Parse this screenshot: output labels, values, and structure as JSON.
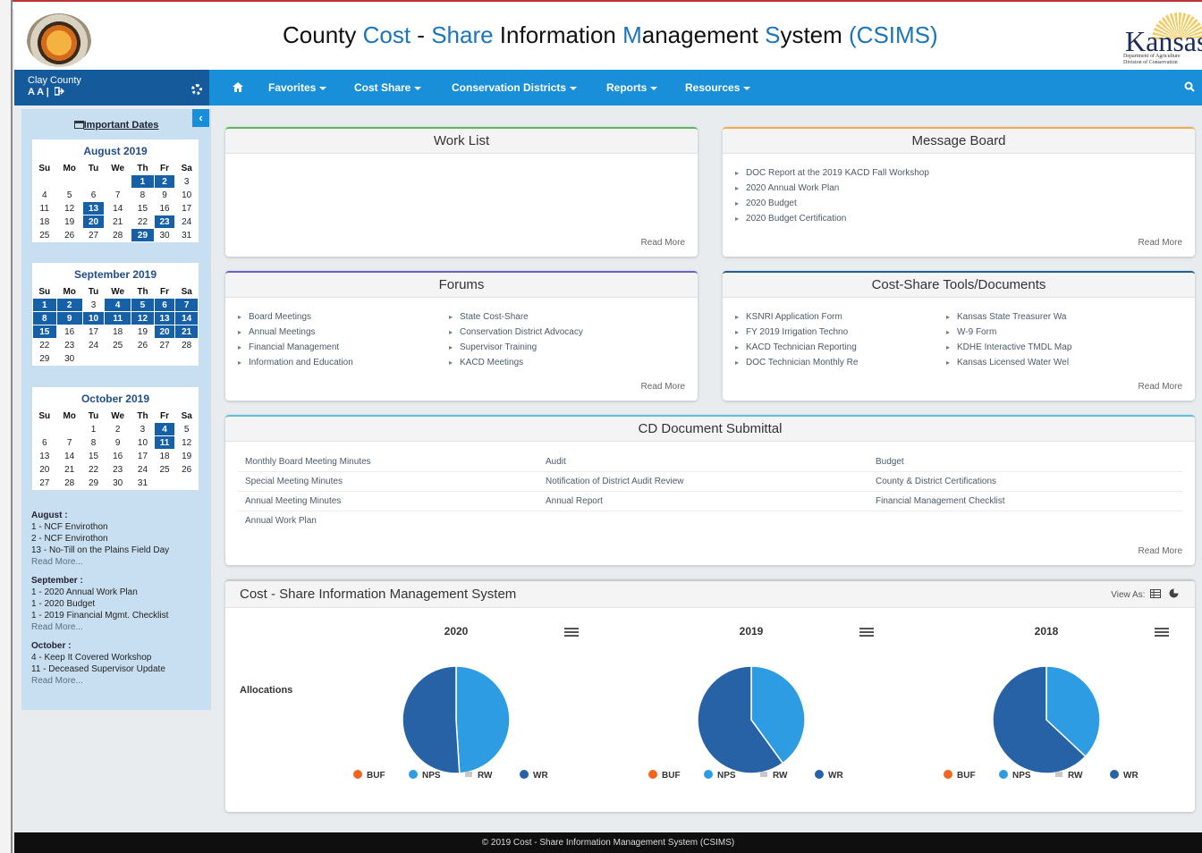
{
  "header": {
    "title_parts": [
      {
        "text": "County ",
        "hl": false
      },
      {
        "text": "Cost",
        "hl": true
      },
      {
        "text": " - ",
        "hl": false
      },
      {
        "text": "Share ",
        "hl": true
      },
      {
        "text": "Information ",
        "hl": false
      },
      {
        "text": "M",
        "hl": true
      },
      {
        "text": "anagement ",
        "hl": false
      },
      {
        "text": "S",
        "hl": true
      },
      {
        "text": "ystem ",
        "hl": false
      },
      {
        "text": "(CSIMS)",
        "hl": true
      }
    ],
    "logo_word": "Kansas",
    "logo_sub1": "Department of Agriculture",
    "logo_sub2": "Division of Conservation"
  },
  "sidebar_head": {
    "county": "Clay County",
    "aa": "A A  |"
  },
  "nav": [
    {
      "label": "Favorites"
    },
    {
      "label": "Cost Share"
    },
    {
      "label": "Conservation Districts"
    },
    {
      "label": "Reports"
    },
    {
      "label": "Resources"
    }
  ],
  "sidebar": {
    "important_dates": "Important Dates",
    "day_headers": [
      "Su",
      "Mo",
      "Tu",
      "We",
      "Th",
      "Fr",
      "Sa"
    ],
    "calendars": [
      {
        "title": "August 2019",
        "weeks": [
          [
            "",
            "",
            "",
            "",
            "1",
            "2",
            "3"
          ],
          [
            "4",
            "5",
            "6",
            "7",
            "8",
            "9",
            "10"
          ],
          [
            "11",
            "12",
            "13",
            "14",
            "15",
            "16",
            "17"
          ],
          [
            "18",
            "19",
            "20",
            "21",
            "22",
            "23",
            "24"
          ],
          [
            "25",
            "26",
            "27",
            "28",
            "29",
            "30",
            "31"
          ]
        ],
        "highlight": [
          "1",
          "2",
          "13",
          "20",
          "23",
          "29"
        ]
      },
      {
        "title": "September 2019",
        "weeks": [
          [
            "1",
            "2",
            "3",
            "4",
            "5",
            "6",
            "7"
          ],
          [
            "8",
            "9",
            "10",
            "11",
            "12",
            "13",
            "14"
          ],
          [
            "15",
            "16",
            "17",
            "18",
            "19",
            "20",
            "21"
          ],
          [
            "22",
            "23",
            "24",
            "25",
            "26",
            "27",
            "28"
          ],
          [
            "29",
            "30",
            "",
            "",
            "",
            "",
            ""
          ]
        ],
        "highlight": [
          "1",
          "2",
          "4",
          "5",
          "6",
          "7",
          "8",
          "9",
          "10",
          "11",
          "12",
          "13",
          "14",
          "15",
          "20",
          "21"
        ]
      },
      {
        "title": "October 2019",
        "weeks": [
          [
            "",
            "",
            "1",
            "2",
            "3",
            "4",
            "5"
          ],
          [
            "6",
            "7",
            "8",
            "9",
            "10",
            "11",
            "12"
          ],
          [
            "13",
            "14",
            "15",
            "16",
            "17",
            "18",
            "19"
          ],
          [
            "20",
            "21",
            "22",
            "23",
            "24",
            "25",
            "26"
          ],
          [
            "27",
            "28",
            "29",
            "30",
            "31",
            "",
            ""
          ]
        ],
        "highlight": [
          "4",
          "11"
        ]
      }
    ],
    "events": [
      {
        "head": "August :",
        "items": [
          "1 - NCF Envirothon",
          "2 - NCF Envirothon",
          "13 - No-Till on the Plains Field Day"
        ],
        "more": "Read More..."
      },
      {
        "head": "September :",
        "items": [
          "1 - 2020 Annual Work Plan",
          "1 - 2020 Budget",
          "1 - 2019 Financial Mgmt. Checklist"
        ],
        "more": "Read More..."
      },
      {
        "head": "October :",
        "items": [
          "4 - Keep It Covered Workshop",
          "11 - Deceased Supervisor Update"
        ],
        "more": "Read More..."
      }
    ]
  },
  "panels": {
    "work_list": {
      "title": "Work List",
      "read_more": "Read More"
    },
    "message_board": {
      "title": "Message Board",
      "items": [
        "DOC Report at the 2019 KACD Fall Workshop",
        "2020 Annual Work Plan",
        "2020 Budget",
        "2020 Budget Certification"
      ],
      "read_more": "Read More"
    },
    "forums": {
      "title": "Forums",
      "col1": [
        "Board Meetings",
        "Annual Meetings",
        "Financial Management",
        "Information and Education"
      ],
      "col2": [
        "State Cost-Share",
        "Conservation District Advocacy",
        "Supervisor Training",
        "KACD Meetings"
      ],
      "read_more": "Read More"
    },
    "tools": {
      "title": "Cost-Share Tools/Documents",
      "col1": [
        "KSNRI Application Form",
        "FY 2019 Irrigation Techno",
        "KACD Technician Reporting",
        "DOC Technician Monthly Re"
      ],
      "col2": [
        "Kansas State Treasurer Wa",
        "W-9 Form",
        "KDHE Interactive TMDL Map",
        "Kansas Licensed Water Wel"
      ],
      "read_more": "Read More"
    },
    "cd_docs": {
      "title": "CD Document Submittal",
      "rows": [
        [
          "Monthly Board Meeting Minutes",
          "Audit",
          "Budget"
        ],
        [
          "Special Meeting Minutes",
          "Notification of District Audit Review",
          "County & District Certifications"
        ],
        [
          "Annual Meeting Minutes",
          "Annual Report",
          "Financial Management Checklist"
        ],
        [
          "Annual Work Plan",
          "",
          ""
        ]
      ],
      "read_more": "Read More"
    }
  },
  "charts_panel": {
    "title": "Cost - Share Information Management System",
    "view_as": "View As:",
    "row_label": "Allocations"
  },
  "chart_data": [
    {
      "type": "pie",
      "title": "2020",
      "labels": [
        "BUF",
        "NPS",
        "RW",
        "WR"
      ],
      "values": [
        0,
        49,
        0,
        51
      ],
      "colors": [
        "#f4641d",
        "#2e9ce2",
        "#c8c8c8",
        "#2862a6"
      ]
    },
    {
      "type": "pie",
      "title": "2019",
      "labels": [
        "BUF",
        "NPS",
        "RW",
        "WR"
      ],
      "values": [
        0,
        40,
        0,
        60
      ],
      "colors": [
        "#f4641d",
        "#2e9ce2",
        "#c8c8c8",
        "#2862a6"
      ]
    },
    {
      "type": "pie",
      "title": "2018",
      "labels": [
        "BUF",
        "NPS",
        "RW",
        "WR"
      ],
      "values": [
        0,
        37,
        0,
        63
      ],
      "colors": [
        "#f4641d",
        "#2e9ce2",
        "#c8c8c8",
        "#2862a6"
      ]
    }
  ],
  "footer": "© 2019 Cost - Share Information Management System (CSIMS)"
}
